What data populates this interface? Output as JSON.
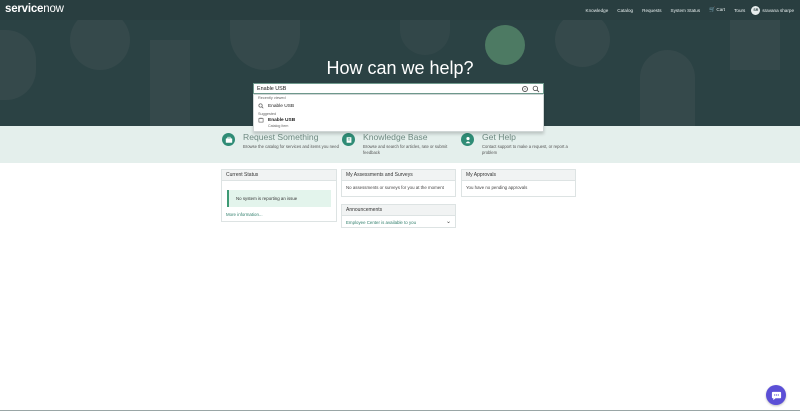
{
  "header": {
    "logo_main": "service",
    "logo_tail": "now",
    "nav": [
      {
        "label": "Knowledge"
      },
      {
        "label": "Catalog"
      },
      {
        "label": "Requests"
      },
      {
        "label": "System Status"
      }
    ],
    "cart_label": "Cart",
    "tours_label": "Tours",
    "avatar_initials": "SR",
    "user_name": "sravana sharpe"
  },
  "hero": {
    "title": "How can we help?"
  },
  "search": {
    "value": "Enable USB",
    "recent_heading": "Recently viewed",
    "recent_item": "Enable USB",
    "suggested_heading": "Suggested",
    "suggested_item": "Enable USB",
    "suggested_sub": "Catalog Item"
  },
  "features": [
    {
      "title": "Request Something",
      "desc": "Browse the catalog for services and items you need",
      "icon": "briefcase-icon"
    },
    {
      "title": "Knowledge Base",
      "desc": "Browse and search for articles, rate or submit feedback",
      "icon": "book-icon"
    },
    {
      "title": "Get Help",
      "desc": "Contact support to make a request, or report a problem",
      "icon": "support-icon"
    }
  ],
  "widgets": {
    "current_status": {
      "title": "Current Status",
      "message": "No system is reporting an issue",
      "link": "More information..."
    },
    "assessments": {
      "title": "My Assessments and Surveys",
      "message": "No assessments or surveys for you at the moment"
    },
    "approvals": {
      "title": "My Approvals",
      "message": "You have no pending approvals"
    },
    "announcements": {
      "title": "Announcements",
      "item": "Employee Center is available to you"
    }
  },
  "colors": {
    "header_bg": "#293e40",
    "hero_bg": "#2b4244",
    "accent": "#2f8c76",
    "chat": "#5b4fd6"
  }
}
